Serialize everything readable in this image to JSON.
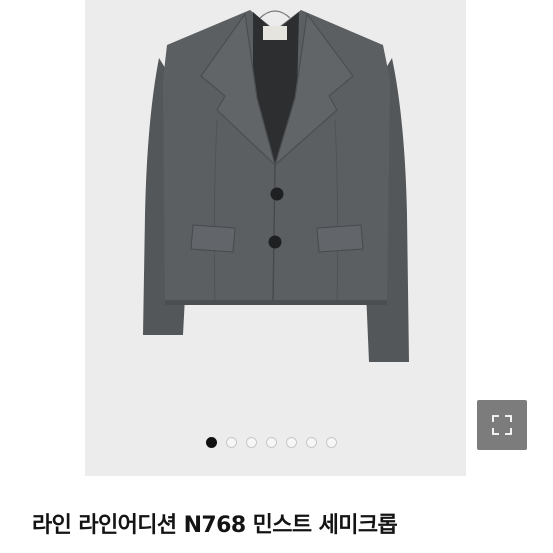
{
  "product": {
    "title": "라인 라인어디션 N768 민스트 세미크롭",
    "image_alt": "Gray semi-crop jacket product photo"
  },
  "gallery": {
    "dot_count": 7,
    "active_index": 0
  },
  "colors": {
    "jacket": "#5a5d60",
    "background": "#ececec",
    "expand_button": "#7c7c7c",
    "active_dot": "#111111"
  },
  "icons": {
    "expand": "expand-icon"
  }
}
